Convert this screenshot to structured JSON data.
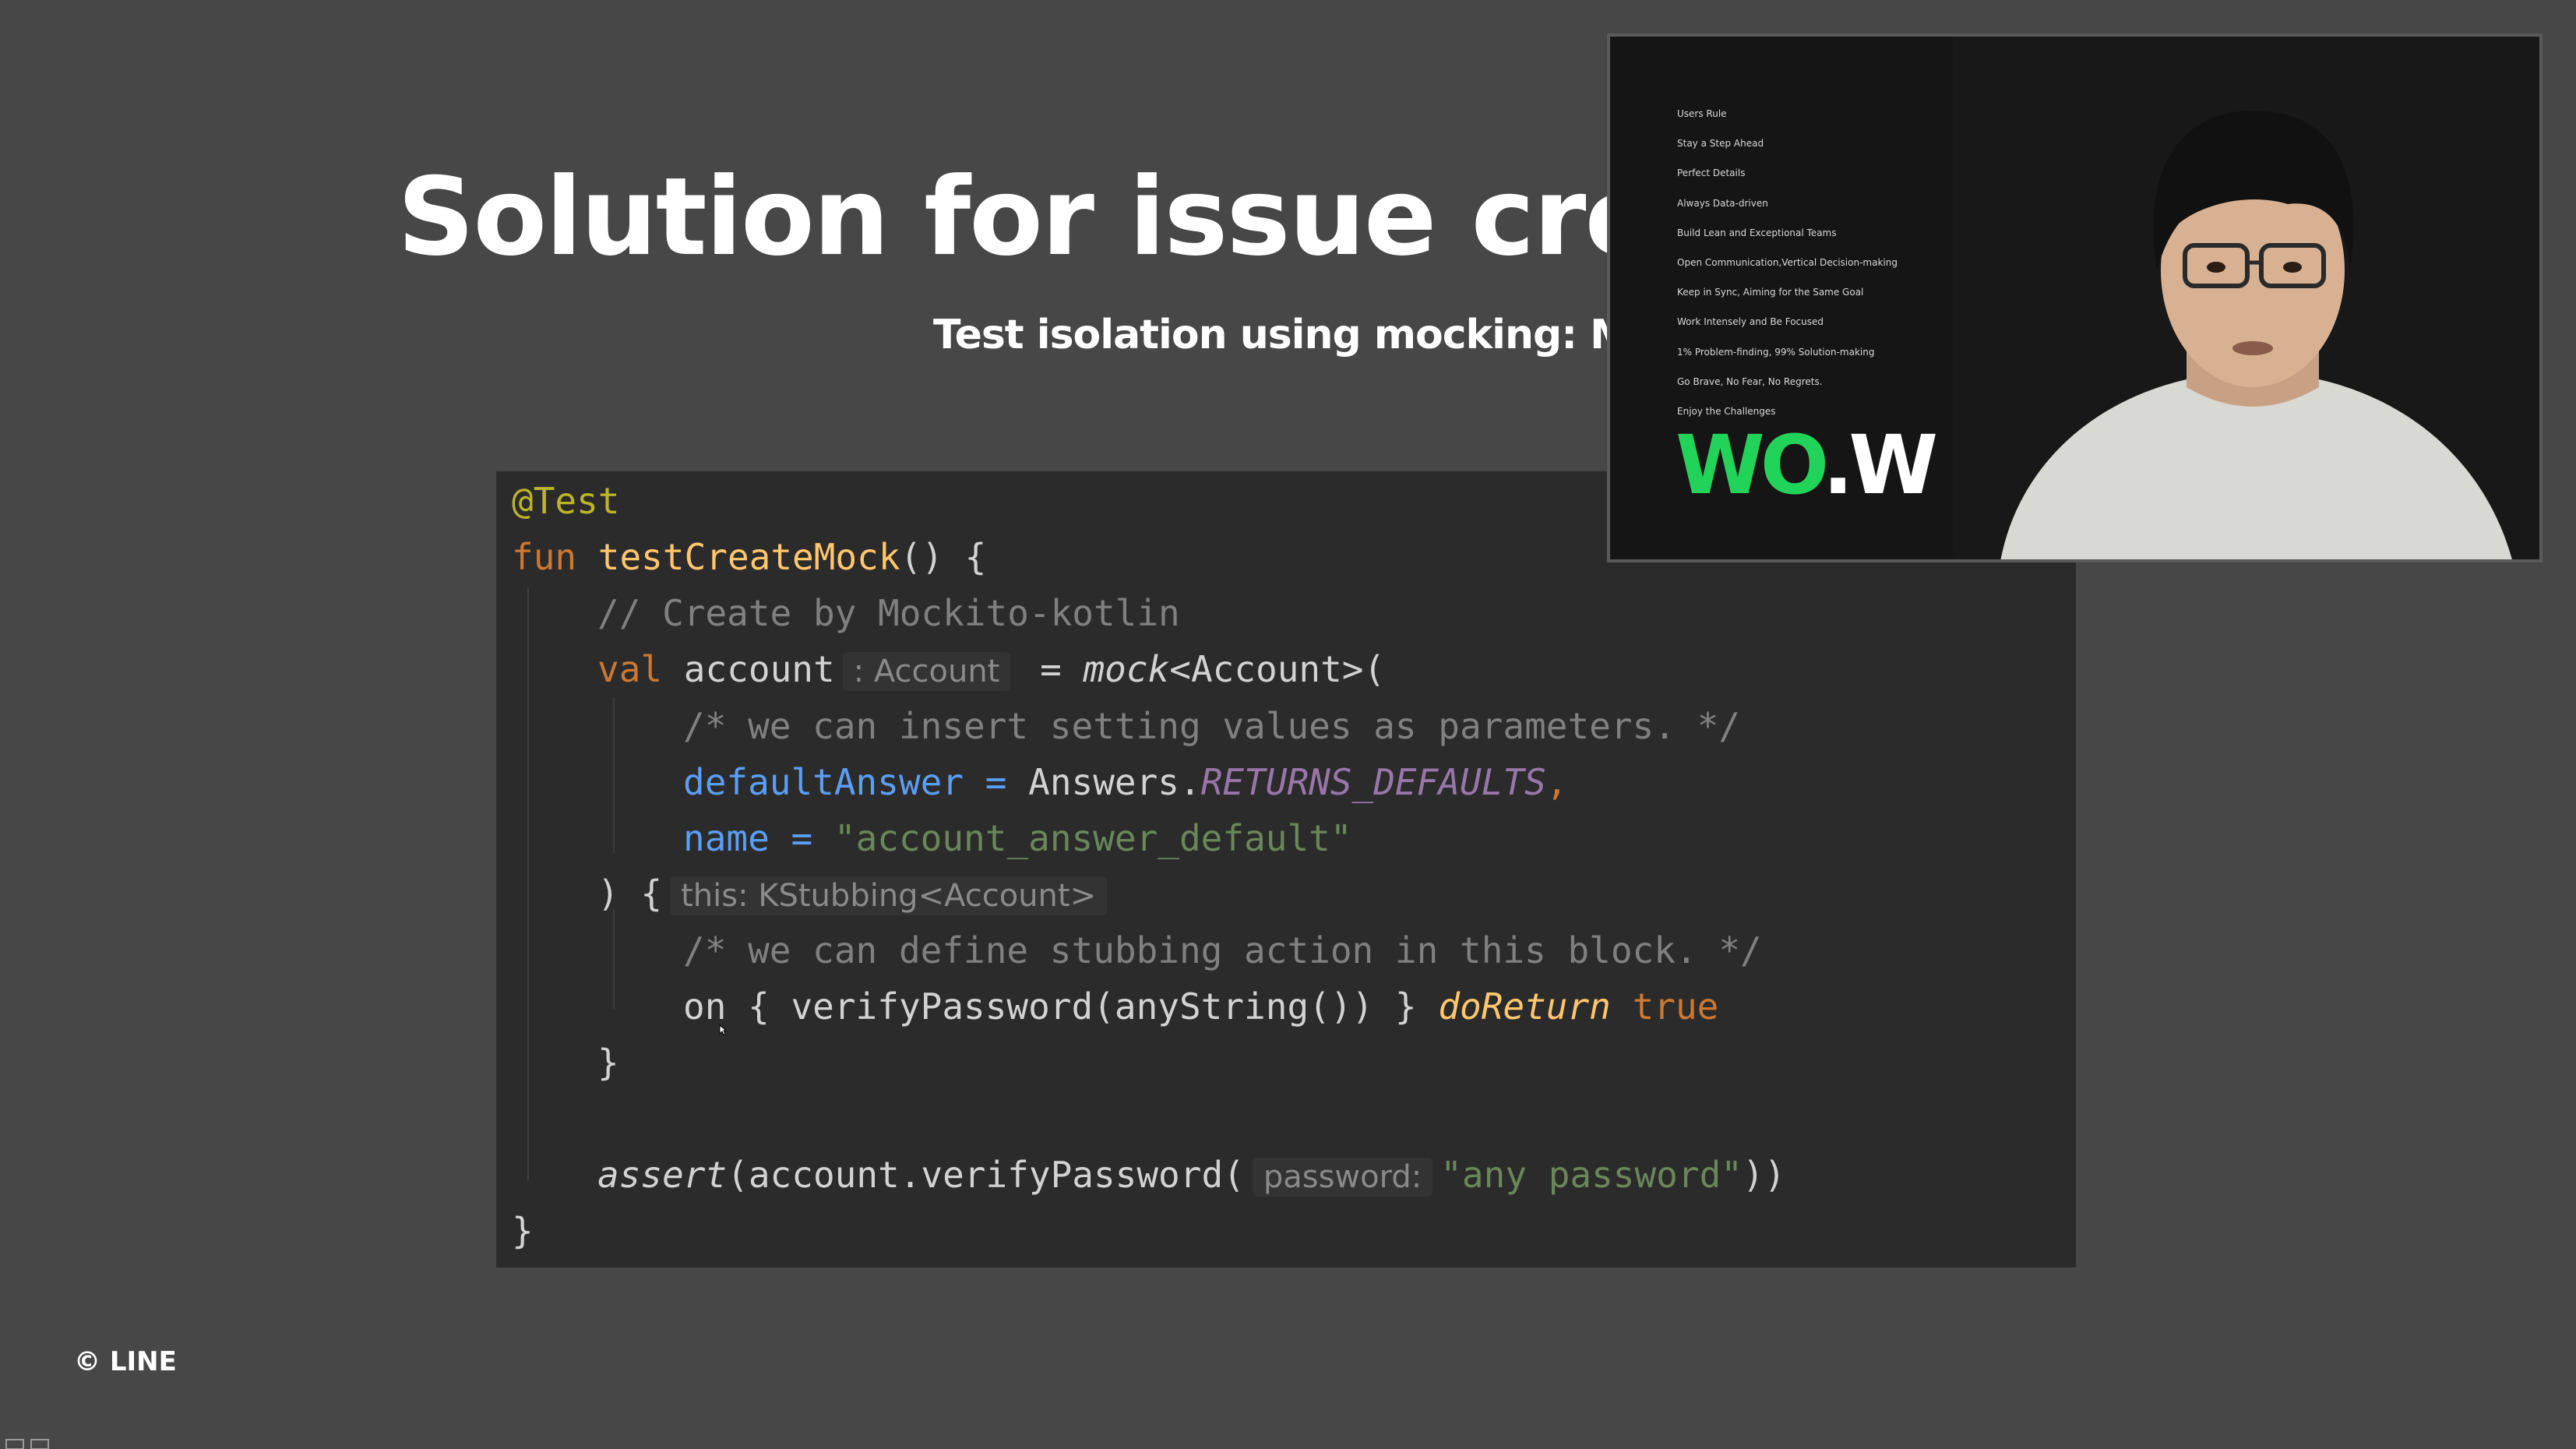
{
  "slide": {
    "title": "Solution for issue creatir",
    "subtitle": "Test isolation using mocking: Moc",
    "watermark": "© LINE"
  },
  "code": {
    "l1_annotation": "@Test",
    "l2_keyword": "fun",
    "l2_name": "testCreateMock",
    "l2_rest": "() {",
    "l3_comment": "// Create by Mockito-kotlin",
    "l4_keyword": "val",
    "l4_var": "account",
    "l4_type_hint": ": Account",
    "l4_eq": " = ",
    "l4_fn": "mock",
    "l4_rest": "<Account>(",
    "l5_comment": "/* we can insert setting values as parameters. */",
    "l6_param": "defaultAnswer",
    "l6_eq": " = ",
    "l6_class": "Answers.",
    "l6_const": "RETURNS_DEFAULTS",
    "l6_comma": ",",
    "l7_param": "name",
    "l7_eq": " = ",
    "l7_str": "\"account_answer_default\"",
    "l8_open": ") {",
    "l8_hint": "this: KStubbing<Account>",
    "l9_comment": "/* we can define stubbing action in this block. */",
    "l10_on": "on { verifyPassword(anyString()) } ",
    "l10_doreturn": "doReturn",
    "l10_space": " ",
    "l10_true": "true",
    "l11_close": "}",
    "l13_fn": "assert",
    "l13_open": "(account.verifyPassword(",
    "l13_hint": "password:",
    "l13_str": "\"any password\"",
    "l13_close": "))",
    "l14_close": "}"
  },
  "speaker_video": {
    "values": [
      "Users Rule",
      "Stay a Step Ahead",
      "Perfect Details",
      "Always Data-driven",
      "Build Lean and Exceptional Teams",
      "Open Communication,Vertical Decision-making",
      "Keep in Sync, Aiming for the Same Goal",
      "Work Intensely and Be Focused",
      "1% Problem-finding, 99% Solution-making",
      "Go Brave, No Fear, No Regrets.",
      "Enjoy the Challenges"
    ],
    "logo_part1": "WO",
    "logo_part2": ".W"
  },
  "colors": {
    "background": "#474747",
    "code_background": "#2b2b2b",
    "annotation": "#bbb529",
    "keyword": "#cc7832",
    "function": "#ffc66d",
    "comment": "#808080",
    "parameter": "#5a9ef5",
    "string": "#6a8759",
    "constant": "#9876aa",
    "logo_green": "#22d35a"
  }
}
